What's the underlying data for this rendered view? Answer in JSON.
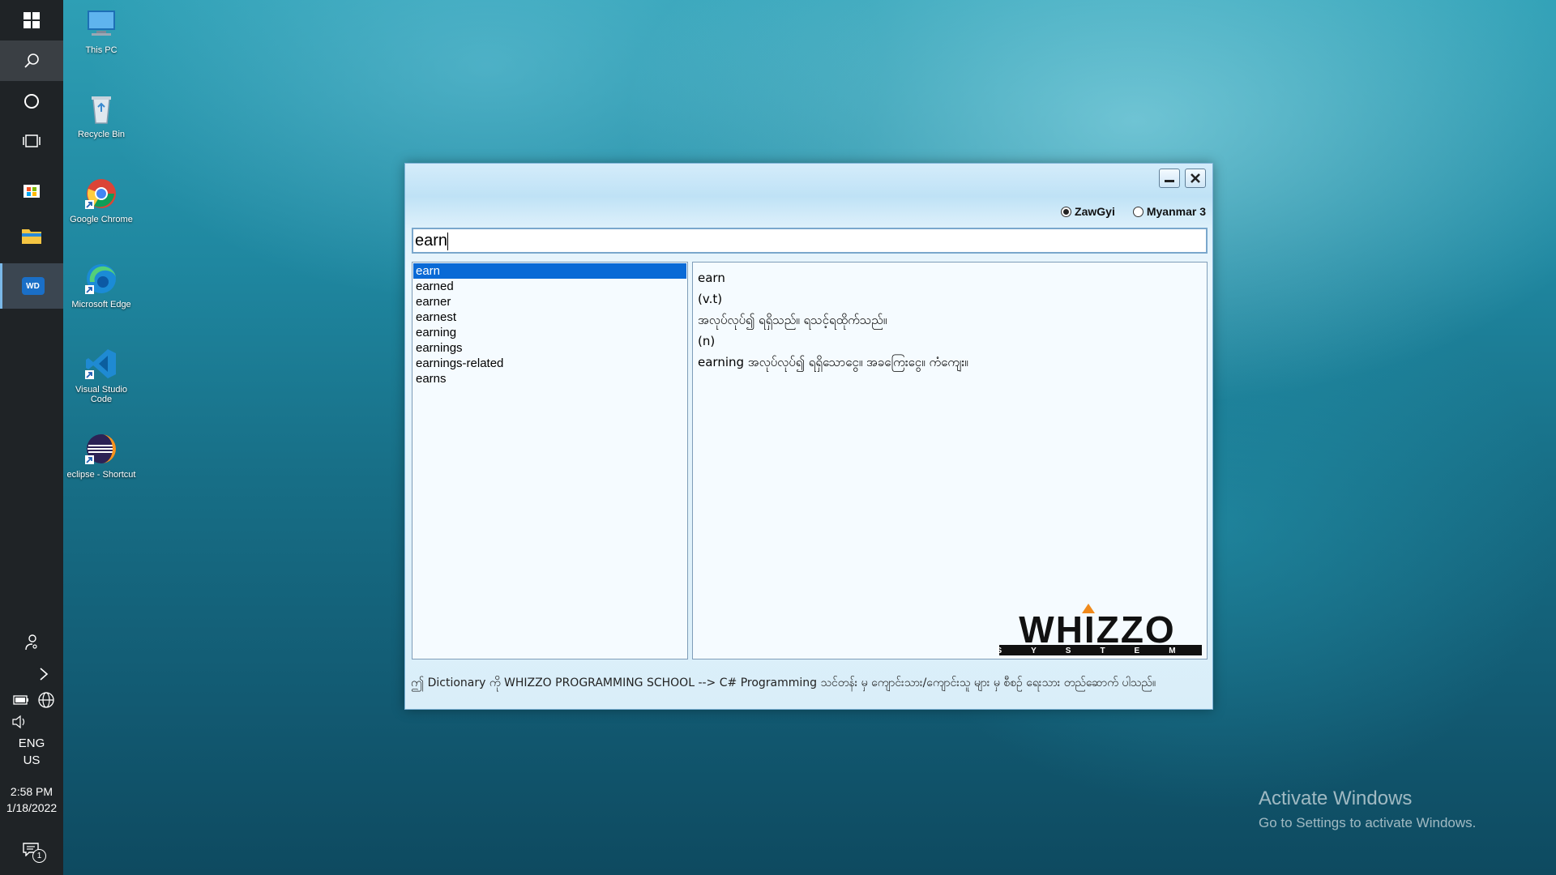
{
  "taskbar": {
    "language_line1": "ENG",
    "language_line2": "US",
    "time": "2:58 PM",
    "date": "1/18/2022",
    "notification_count": "1",
    "active_app_label": "WD"
  },
  "desktop": {
    "icons": [
      {
        "label": "This PC",
        "icon": "this-pc-icon"
      },
      {
        "label": "Recycle Bin",
        "icon": "recycle-bin-icon"
      },
      {
        "label": "Google Chrome",
        "icon": "chrome-icon"
      },
      {
        "label": "Microsoft Edge",
        "icon": "edge-icon"
      },
      {
        "label": "Visual Studio Code",
        "icon": "vscode-icon"
      },
      {
        "label": "eclipse - Shortcut",
        "icon": "eclipse-icon"
      }
    ]
  },
  "app": {
    "encoding_options": [
      {
        "label": "ZawGyi",
        "selected": true
      },
      {
        "label": "Myanmar 3",
        "selected": false
      }
    ],
    "search_value": "earn",
    "words": [
      "earn",
      "earned",
      "earner",
      "earnest",
      "earning",
      "earnings",
      "earnings-related",
      "earns"
    ],
    "selected_word_index": 0,
    "definition": [
      "earn",
      "(v.t)",
      "အလုပ်လုပ်၍ ရရှိသည်။ ရသင့်ရထိုက်သည်။",
      "(n)",
      "earning အလုပ်လုပ်၍ ရရှိသောငွေ။ အခကြေးငွေ။ ကံကျေး။"
    ],
    "logo_text": "WHIZZO",
    "logo_sub": "SYSTEM",
    "footer": "ဤ Dictionary ကို WHIZZO PROGRAMMING SCHOOL --> C# Programming သင်တန်း မှ ကျောင်းသား/ကျောင်းသူ များ မှ စီစဉ် ရေးသား တည်ဆောက် ပါသည်။"
  },
  "watermark": {
    "title": "Activate Windows",
    "subtitle": "Go to Settings to activate Windows."
  }
}
